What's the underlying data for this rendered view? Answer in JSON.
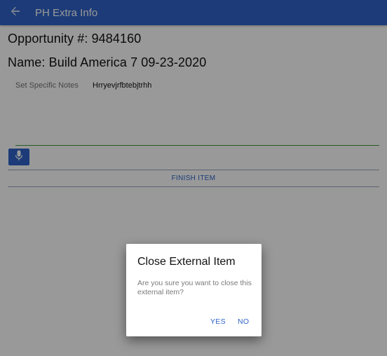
{
  "appbar": {
    "title": "PH Extra Info",
    "back_icon": "arrow-left-icon",
    "color": "#2f63c9"
  },
  "main": {
    "opportunity_line": "Opportunity #: 9484160",
    "name_line": "Name: Build America 7 09-23-2020",
    "notes_label": "Set Specific Notes",
    "notes_value": "Hrryevjrfbtebjtrhh",
    "mic_icon": "microphone-icon",
    "finish_button": "FINISH ITEM",
    "underline_color": "#3c9a3c"
  },
  "dialog": {
    "title": "Close External Item",
    "message": "Are you sure you want to close this external item?",
    "yes_label": "YES",
    "no_label": "NO"
  }
}
